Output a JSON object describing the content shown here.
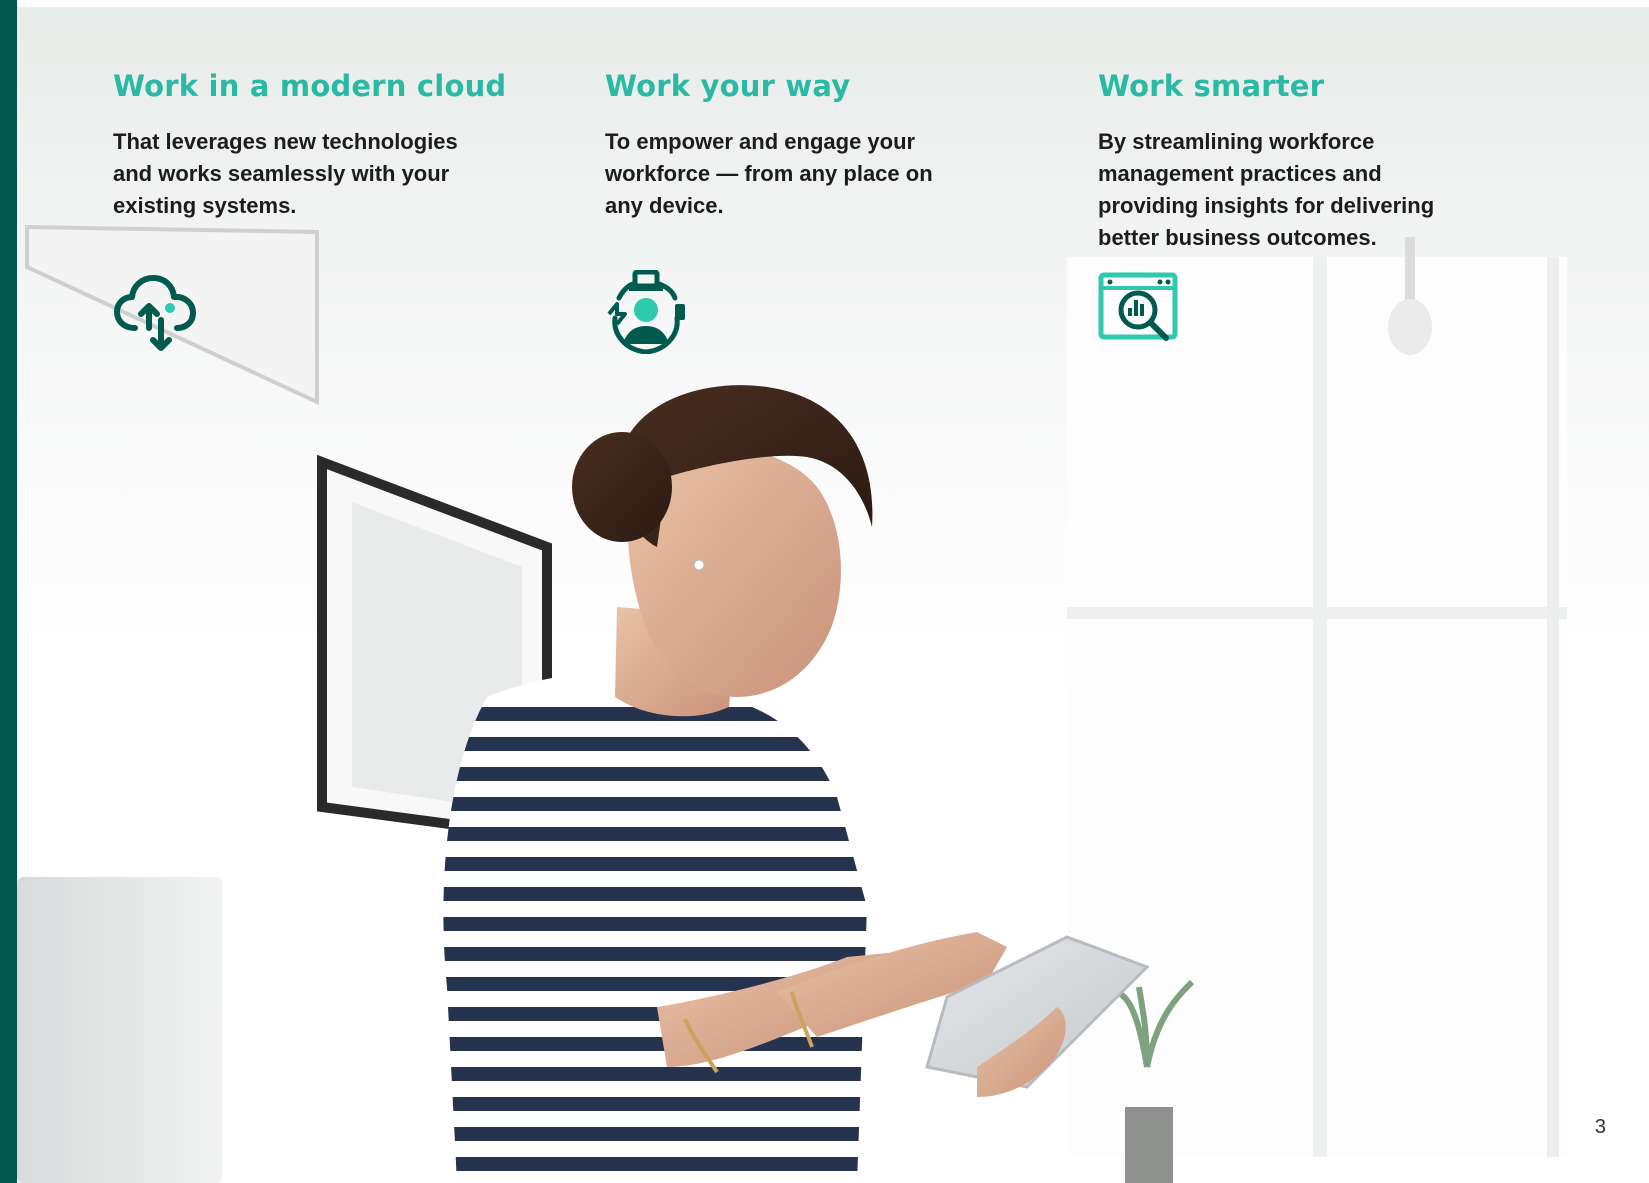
{
  "columns": [
    {
      "title": "Work in a modern cloud",
      "body": "That leverages new technologies\nand works seamlessly with your\nexisting systems.",
      "icon": "cloud-sync-icon"
    },
    {
      "title": "Work your way",
      "body": "To empower and engage your\nworkforce — from any place on\nany device.",
      "icon": "person-devices-icon"
    },
    {
      "title": "Work smarter",
      "body": "By streamlining workforce\nmanagement practices and\nproviding insights for delivering\nbetter business outcomes.",
      "icon": "analytics-search-icon"
    }
  ],
  "page_number": "3",
  "colors": {
    "sidebar": "#00574b",
    "heading": "#2ab9a3",
    "icon_dark": "#005a4e",
    "icon_accent": "#2fc9b0",
    "body_text": "#1c1c1c"
  }
}
